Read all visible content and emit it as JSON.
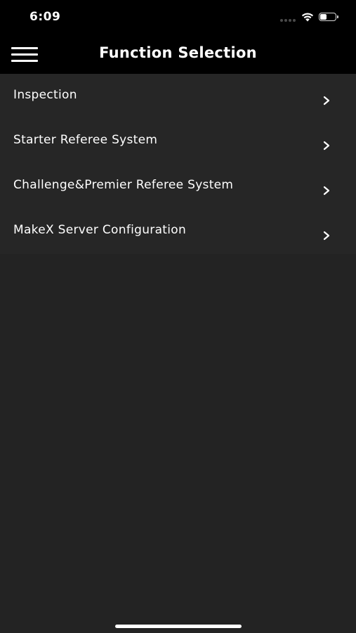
{
  "status_bar": {
    "time": "6:09",
    "battery_level": 0.45
  },
  "header": {
    "title": "Function Selection"
  },
  "menu": {
    "items": [
      {
        "label": "Inspection"
      },
      {
        "label": "Starter Referee System"
      },
      {
        "label": "Challenge&Premier Referee System"
      },
      {
        "label": "MakeX Server Configuration"
      }
    ]
  },
  "colors": {
    "background": "#232323",
    "bar": "#000000",
    "row": "#262626",
    "text": "#ffffff"
  },
  "icons": {
    "menu": "hamburger-menu-icon",
    "row_action": "chevron-right-icon",
    "wifi": "wifi-icon",
    "battery": "battery-icon",
    "signal": "cellular-signal-icon"
  }
}
